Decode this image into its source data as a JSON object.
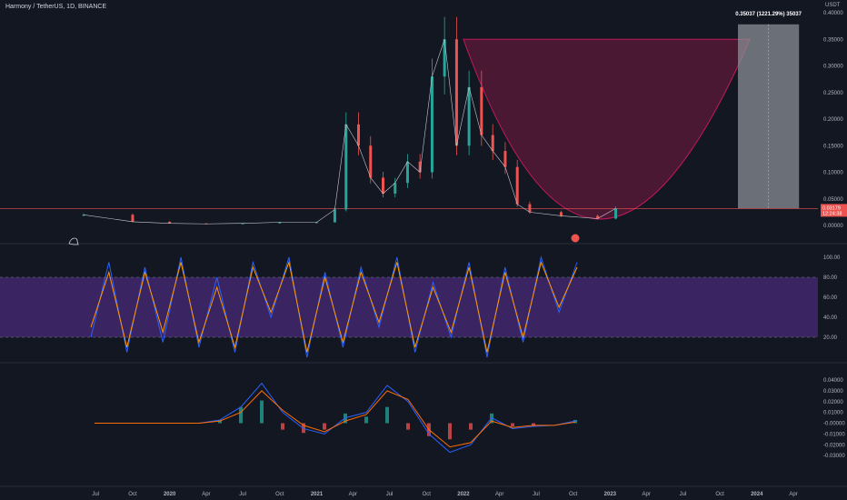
{
  "header": {
    "symbol_title": "Harmony / TetherUS, 1D, BINANCE",
    "unit": "USDT"
  },
  "annotation": {
    "measure_label": "0.35037 (1221.29%) 35037"
  },
  "price_badge": {
    "price": "0.03179",
    "countdown": "12:24:38"
  },
  "colors": {
    "background": "#131722",
    "up": "#26a69a",
    "down": "#ef5350",
    "cup_fill": "#5d1a3a",
    "cup_stroke": "#c2185b",
    "rsi_band": "#4a2a78",
    "stoch_k": "#2962ff",
    "stoch_d": "#ff9800",
    "macd": "#2962ff",
    "signal": "#ff6d00",
    "measure_box": "#8a8d95"
  },
  "chart_data": [
    {
      "type": "candlestick",
      "pane": "price",
      "title": "Harmony / TetherUS, 1D, BINANCE",
      "ylabel": "USDT",
      "ylim": [
        0,
        0.4
      ],
      "yticks": [
        "0.40000",
        "0.35000",
        "0.30000",
        "0.25000",
        "0.20000",
        "0.15000",
        "0.10000",
        "0.05000",
        "0.00000"
      ],
      "x": [
        "2019-06-01",
        "2019-10-01",
        "2020-01-01",
        "2020-04-01",
        "2020-07-01",
        "2020-10-01",
        "2021-01-01",
        "2021-02-15",
        "2021-03-15",
        "2021-04-15",
        "2021-05-15",
        "2021-06-15",
        "2021-07-15",
        "2021-08-15",
        "2021-09-15",
        "2021-10-15",
        "2021-11-15",
        "2021-12-15",
        "2022-01-15",
        "2022-02-15",
        "2022-03-15",
        "2022-04-15",
        "2022-05-15",
        "2022-06-15",
        "2022-09-01",
        "2022-12-01",
        "2023-01-15"
      ],
      "close": [
        0.02,
        0.007,
        0.004,
        0.003,
        0.004,
        0.006,
        0.006,
        0.03,
        0.19,
        0.15,
        0.09,
        0.06,
        0.08,
        0.12,
        0.1,
        0.28,
        0.35,
        0.15,
        0.26,
        0.17,
        0.14,
        0.11,
        0.04,
        0.025,
        0.018,
        0.013,
        0.032
      ],
      "xticks": [
        "Jul",
        "Oct",
        "2020",
        "Apr",
        "Jul",
        "Oct",
        "2021",
        "Apr",
        "Jul",
        "Oct",
        "2022",
        "Apr",
        "Jul",
        "Oct",
        "2023",
        "Apr",
        "Jul",
        "Oct",
        "2024",
        "Apr"
      ],
      "last_price": 0.03179
    },
    {
      "type": "line",
      "pane": "stochastic-rsi",
      "ylim": [
        0,
        100
      ],
      "yticks": [
        "100.00",
        "80.00",
        "60.00",
        "40.00",
        "20.00"
      ],
      "band": [
        20,
        80
      ],
      "series": [
        {
          "values": [
            20,
            95,
            5,
            90,
            15,
            100,
            10,
            80,
            5,
            95,
            40,
            100,
            0,
            85,
            10,
            90,
            30,
            100,
            5,
            75,
            20,
            95,
            0,
            90,
            15,
            100,
            45,
            95
          ]
        },
        {
          "values": [
            30,
            85,
            10,
            85,
            25,
            95,
            15,
            70,
            10,
            90,
            45,
            95,
            5,
            80,
            15,
            85,
            35,
            95,
            10,
            70,
            25,
            90,
            5,
            85,
            20,
            95,
            50,
            90
          ]
        }
      ]
    },
    {
      "type": "line",
      "pane": "macd",
      "ylim": [
        -0.04,
        0.04
      ],
      "yticks": [
        "0.04000",
        "0.03000",
        "0.02000",
        "0.01000",
        "-0.00000",
        "-0.01000",
        "-0.02000",
        "-0.03000"
      ],
      "series": [
        {
          "values": [
            0,
            0,
            0,
            0,
            0,
            0,
            0.003,
            0.015,
            0.037,
            0.01,
            -0.005,
            -0.01,
            0.005,
            0.01,
            0.035,
            0.02,
            -0.01,
            -0.027,
            -0.02,
            0.005,
            -0.005,
            -0.003,
            -0.002,
            0.002
          ]
        },
        {
          "values": [
            0,
            0,
            0,
            0,
            0,
            0,
            0.002,
            0.01,
            0.03,
            0.012,
            -0.002,
            -0.008,
            0.002,
            0.008,
            0.03,
            0.022,
            -0.006,
            -0.022,
            -0.018,
            0.002,
            -0.004,
            -0.002,
            -0.002,
            0.001
          ]
        }
      ]
    }
  ]
}
